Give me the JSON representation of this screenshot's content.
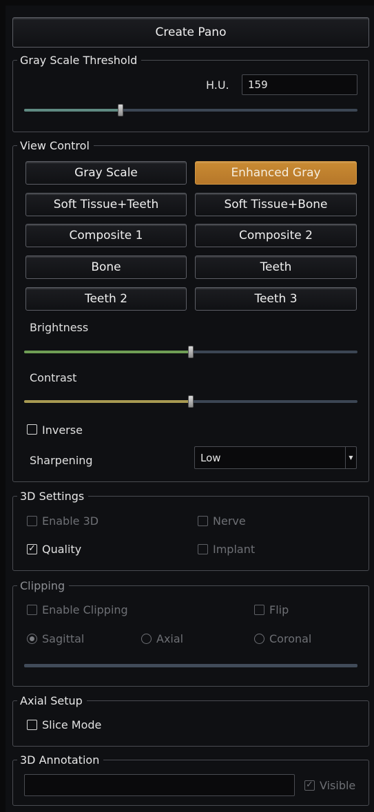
{
  "create_pano": {
    "label": "Create Pano"
  },
  "gray_scale_threshold": {
    "title": "Gray Scale Threshold",
    "hu_label": "H.U.",
    "hu_value": "159",
    "slider_value": 0.29
  },
  "view_control": {
    "title": "View Control",
    "buttons": [
      {
        "label": "Gray Scale",
        "selected": false
      },
      {
        "label": "Enhanced Gray",
        "selected": true
      },
      {
        "label": "Soft Tissue+Teeth",
        "selected": false
      },
      {
        "label": "Soft Tissue+Bone",
        "selected": false
      },
      {
        "label": "Composite 1",
        "selected": false
      },
      {
        "label": "Composite 2",
        "selected": false
      },
      {
        "label": "Bone",
        "selected": false
      },
      {
        "label": "Teeth",
        "selected": false
      },
      {
        "label": "Teeth 2",
        "selected": false
      },
      {
        "label": "Teeth 3",
        "selected": false
      }
    ],
    "brightness_label": "Brightness",
    "brightness_value": 0.5,
    "contrast_label": "Contrast",
    "contrast_value": 0.5,
    "inverse_label": "Inverse",
    "inverse_checked": false,
    "sharpening_label": "Sharpening",
    "sharpening_value": "Low"
  },
  "settings_3d": {
    "title": "3D Settings",
    "enable_3d_label": "Enable 3D",
    "nerve_label": "Nerve",
    "quality_label": "Quality",
    "quality_checked": true,
    "implant_label": "Implant"
  },
  "clipping": {
    "title": "Clipping",
    "enable_clipping_label": "Enable Clipping",
    "flip_label": "Flip",
    "sagittal_label": "Sagittal",
    "axial_label": "Axial",
    "coronal_label": "Coronal",
    "selected_plane": "Sagittal"
  },
  "axial_setup": {
    "title": "Axial Setup",
    "slice_mode_label": "Slice Mode"
  },
  "annotation_3d": {
    "title": "3D Annotation",
    "text_value": "",
    "visible_label": "Visible",
    "visible_checked": true
  },
  "colors": {
    "accent_orange": "#c0802f",
    "gray_fill": "#5f8a82",
    "brightness_fill": "#6f9e55",
    "contrast_fill": "#a89a52",
    "track": "#3c4654"
  }
}
